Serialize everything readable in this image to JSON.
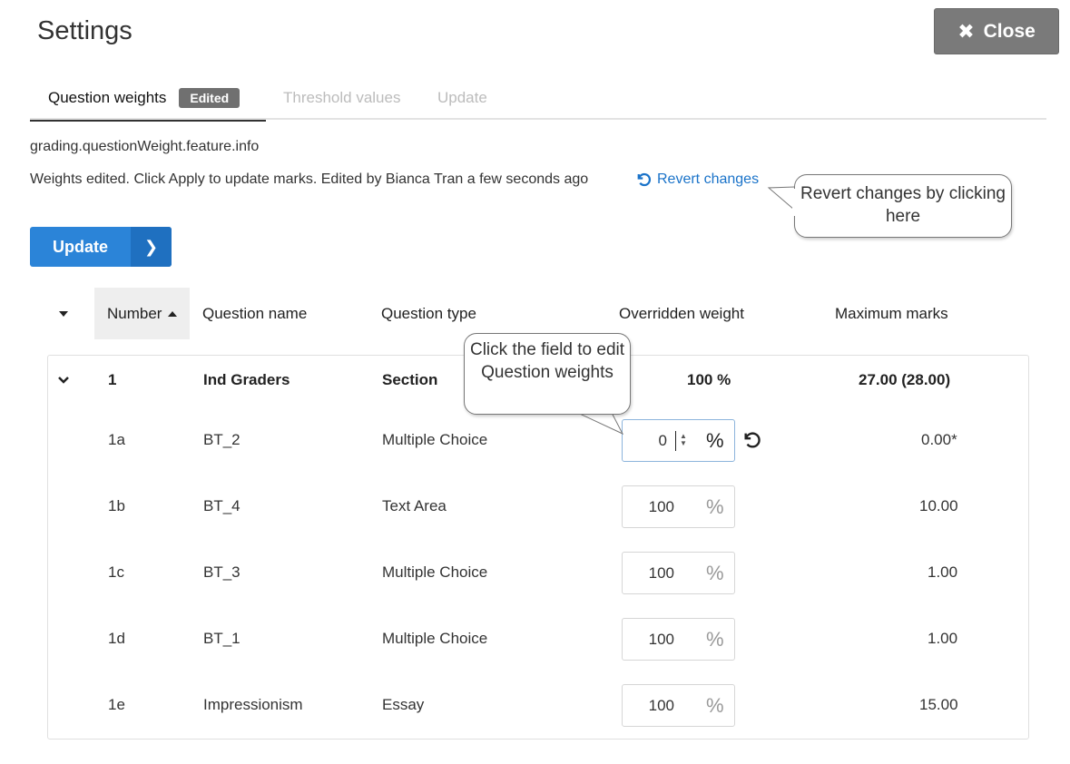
{
  "page": {
    "title": "Settings",
    "close_label": "Close"
  },
  "tabs": [
    {
      "label": "Question weights",
      "badge": "Edited"
    },
    {
      "label": "Threshold values"
    },
    {
      "label": "Update"
    }
  ],
  "info": {
    "feature_info": "grading.questionWeight.feature.info",
    "edited_message": "Weights edited. Click Apply to update marks. Edited by Bianca Tran a few seconds ago",
    "revert_label": "Revert changes"
  },
  "tooltips": {
    "revert": "Revert changes by clicking here",
    "weight_field": "Click the field to edit Question weights"
  },
  "update_button": {
    "label": "Update"
  },
  "table": {
    "headers": {
      "number": "Number",
      "name": "Question name",
      "type": "Question type",
      "weight": "Overridden weight",
      "max": "Maximum marks"
    },
    "section": {
      "number": "1",
      "name": "Ind Graders",
      "type": "Section",
      "weight": "100 %",
      "max": "27.00 (28.00)"
    },
    "rows": [
      {
        "number": "1a",
        "name": "BT_2",
        "type": "Multiple Choice",
        "weight": "0",
        "max": "0.00*"
      },
      {
        "number": "1b",
        "name": "BT_4",
        "type": "Text Area",
        "weight": "100",
        "max": "10.00"
      },
      {
        "number": "1c",
        "name": "BT_3",
        "type": "Multiple Choice",
        "weight": "100",
        "max": "1.00"
      },
      {
        "number": "1d",
        "name": "BT_1",
        "type": "Multiple Choice",
        "weight": "100",
        "max": "1.00"
      },
      {
        "number": "1e",
        "name": "Impressionism",
        "type": "Essay",
        "weight": "100",
        "max": "15.00"
      }
    ],
    "percent_symbol": "%"
  },
  "colors": {
    "accent": "#2b84d8",
    "link": "#1a73c9",
    "close_bg": "#7a7a7a",
    "badge_bg": "#707070"
  }
}
